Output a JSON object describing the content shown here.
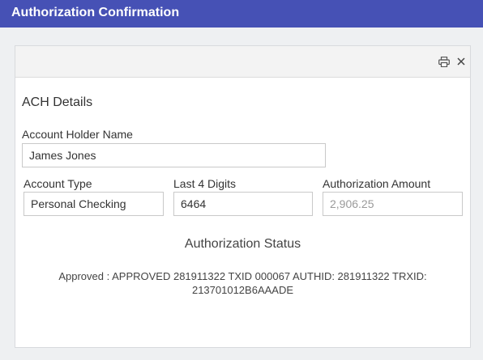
{
  "window": {
    "title": "Authorization Confirmation"
  },
  "panel": {
    "icons": {
      "print": "printer-icon",
      "close": "close-icon"
    },
    "section_title": "ACH Details",
    "account_holder": {
      "label": "Account Holder Name",
      "value": "James Jones"
    },
    "account_type": {
      "label": "Account Type",
      "value": "Personal Checking"
    },
    "last4": {
      "label": "Last 4 Digits",
      "value": "6464"
    },
    "amount": {
      "label": "Authorization Amount",
      "value": "2,906.25"
    },
    "status": {
      "title": "Authorization Status",
      "text": "Approved : APPROVED 281911322 TXID 000067 AUTHID: 281911322 TRXID: 213701012B6AAADE"
    }
  },
  "colors": {
    "title_bar": "#4651b5",
    "background": "#eef0f2"
  }
}
